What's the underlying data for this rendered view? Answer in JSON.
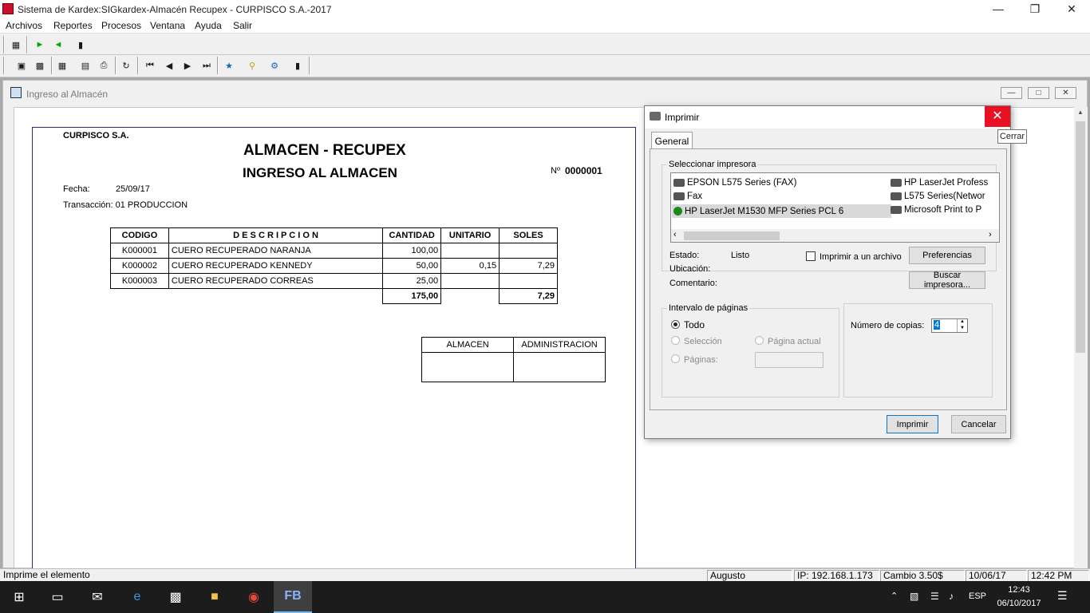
{
  "window": {
    "title": "Sistema de Kardex:SIGkardex-Almacén Recupex  -  CURPISCO S.A.-2017"
  },
  "menu": [
    "Archivos",
    "Reportes",
    "Procesos",
    "Ventana",
    "Ayuda",
    "Salir"
  ],
  "child_window": {
    "title": "Ingreso al Almacén"
  },
  "report": {
    "company": "CURPISCO S.A.",
    "title1": "ALMACEN - RECUPEX",
    "title2": "INGRESO AL ALMACEN",
    "number_label": "Nº",
    "number": "0000001",
    "fecha_label": "Fecha:",
    "fecha": "25/09/17",
    "transaccion": "Transacción:  01  PRODUCCION",
    "headers": [
      "CODIGO",
      "D E S C R I P C I O N",
      "CANTIDAD",
      "UNITARIO",
      "SOLES"
    ],
    "rows": [
      [
        "K000001",
        "CUERO RECUPERADO NARANJA",
        "100,00",
        "",
        ""
      ],
      [
        "K000002",
        "CUERO RECUPERADO KENNEDY",
        "50,00",
        "0,15",
        "7,29"
      ],
      [
        "K000003",
        "CUERO RECUPERADO CORREAS",
        "25,00",
        "",
        ""
      ]
    ],
    "total_cantidad": "175,00",
    "total_soles": "7,29",
    "sign_almacen": "ALMACEN",
    "sign_admin": "ADMINISTRACION"
  },
  "dialog": {
    "title": "Imprimir",
    "close_tooltip": "Cerrar",
    "tab": "General",
    "select_printer": "Seleccionar impresora",
    "printers_col1": [
      "EPSON L575 Series (FAX)",
      "Fax",
      "HP LaserJet M1530 MFP Series PCL 6"
    ],
    "printers_col2": [
      "HP LaserJet Profess",
      "L575 Series(Networ",
      "Microsoft Print to P"
    ],
    "estado_label": "Estado:",
    "estado": "Listo",
    "ubicacion_label": "Ubicación:",
    "comentario_label": "Comentario:",
    "print_to_file": "Imprimir a un archivo",
    "preferencias": "Preferencias",
    "buscar": "Buscar impresora...",
    "range_title": "Intervalo de páginas",
    "todo": "Todo",
    "seleccion": "Selección",
    "pagina_actual": "Página actual",
    "paginas": "Páginas:",
    "copies_label": "Número de copias:",
    "copies": "4",
    "imprimir": "Imprimir",
    "cancelar": "Cancelar"
  },
  "status": {
    "message": "Imprime el elemento",
    "user": "Augusto",
    "ip": "IP: 192.168.1.173",
    "cambio": "Cambio 3.50$",
    "date": "10/06/17",
    "time": "12:42 PM"
  },
  "taskbar": {
    "lang": "ESP",
    "clock_time": "12:43",
    "clock_date": "06/10/2017"
  }
}
